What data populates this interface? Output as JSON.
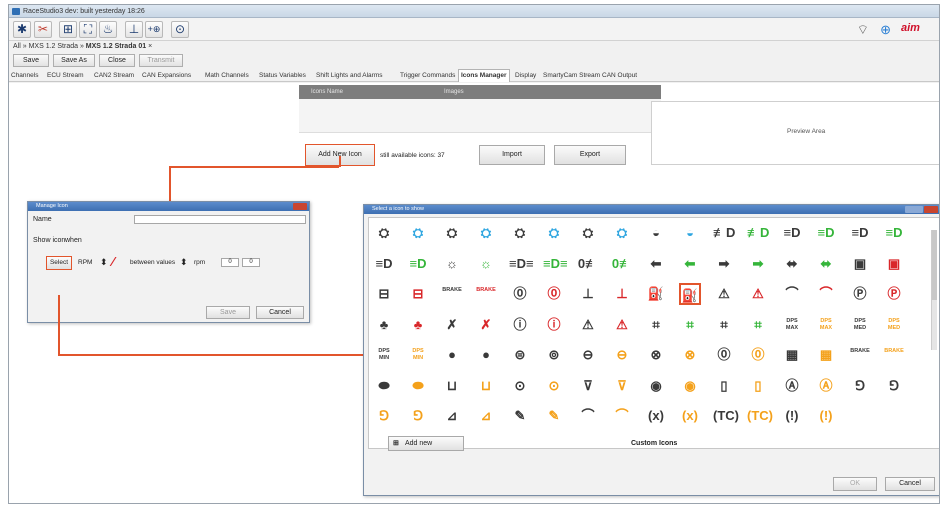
{
  "window": {
    "title": "RaceStudio3 dev: built yesterday 18:26"
  },
  "toolbar": {
    "buttons": [
      "✱",
      "✂",
      "⊞",
      "⛶",
      "♨",
      "⊥",
      "+⊕",
      "⊙"
    ],
    "right_icons": [
      "wifi-icon",
      "globe-icon"
    ],
    "brand": "aim"
  },
  "breadcrumb": {
    "root": "All",
    "item1": "MXS 1.2 Strada",
    "item2": "MXS 1.2 Strada 01"
  },
  "actions": {
    "save": "Save",
    "save_as": "Save As",
    "close": "Close",
    "transmit": "Transmit"
  },
  "tabs": [
    "Channels",
    "ECU Stream",
    "CAN2 Stream",
    "CAN Expansions",
    "Math Channels",
    "Status Variables",
    "Shift Lights and Alarms",
    "Trigger Commands",
    "Icons Manager",
    "Display",
    "SmartyCam Stream",
    "CAN Output"
  ],
  "icons_manager": {
    "col_icons_name": "Icons Name",
    "col_images": "Images",
    "add_new_icon": "Add New Icon",
    "still_available": "still available icons: 37",
    "import": "Import",
    "export": "Export",
    "preview_area": "Preview Area"
  },
  "manage_icon": {
    "title": "Manage Icon",
    "name_label": "Name",
    "name_value": "",
    "show_icon_label": "Show icon",
    "when_label": "when",
    "select_btn": "Select",
    "channel": "RPM",
    "condition": "between values",
    "unit": "rpm",
    "val1": "0",
    "val2": "0",
    "save": "Save",
    "cancel": "Cancel"
  },
  "select_icon": {
    "title": "Select a icon to show",
    "custom_icons": "Custom Icons",
    "add_new": "Add new",
    "ok": "OK",
    "cancel": "Cancel",
    "rows": [
      [
        [
          "dark",
          "⛭"
        ],
        [
          "blue",
          "⛭"
        ],
        [
          "dark",
          "⛭"
        ],
        [
          "blue",
          "⛭"
        ],
        [
          "dark",
          "⛭"
        ],
        [
          "blue",
          "⛭"
        ],
        [
          "dark",
          "⛭"
        ],
        [
          "blue",
          "⛭"
        ],
        [
          "dark",
          "◒"
        ],
        [
          "blue",
          "◒"
        ],
        [
          "dark",
          "≢D"
        ],
        [
          "green",
          "≢D"
        ],
        [
          "dark",
          "≡D"
        ],
        [
          "green",
          "≡D"
        ],
        [
          "dark",
          "≡D"
        ],
        [
          "green",
          "≡D"
        ]
      ],
      [
        [
          "dark",
          "≡D"
        ],
        [
          "green",
          "≡D"
        ],
        [
          "dark",
          "☼"
        ],
        [
          "green",
          "☼"
        ],
        [
          "dark",
          "≡D≡"
        ],
        [
          "green",
          "≡D≡"
        ],
        [
          "dark",
          "0≢"
        ],
        [
          "green",
          "0≢"
        ],
        [
          "dark",
          "⬅"
        ],
        [
          "green",
          "⬅"
        ],
        [
          "dark",
          "➡"
        ],
        [
          "green",
          "➡"
        ],
        [
          "dark",
          "⬌"
        ],
        [
          "green",
          "⬌"
        ],
        [
          "dark",
          "▣"
        ],
        [
          "red",
          "▣"
        ]
      ],
      [
        [
          "dark",
          "⊟"
        ],
        [
          "red",
          "⊟"
        ],
        [
          "small dark",
          "BRAKE"
        ],
        [
          "small red",
          "BRAKE"
        ],
        [
          "dark",
          "⓪"
        ],
        [
          "red",
          "⓪"
        ],
        [
          "dark",
          "⊥"
        ],
        [
          "red",
          "⊥"
        ],
        [
          "dark",
          "⛽"
        ],
        [
          "red",
          "⛽"
        ],
        [
          "dark",
          "⚠"
        ],
        [
          "red",
          "⚠"
        ],
        [
          "dark",
          "⌒"
        ],
        [
          "red",
          "⌒"
        ],
        [
          "dark",
          "Ⓟ"
        ],
        [
          "red",
          "Ⓟ"
        ]
      ],
      [
        [
          "dark",
          "♣"
        ],
        [
          "red",
          "♣"
        ],
        [
          "dark",
          "✗"
        ],
        [
          "red",
          "✗"
        ],
        [
          "dark",
          "ⓘ"
        ],
        [
          "red",
          "ⓘ"
        ],
        [
          "dark",
          "⚠"
        ],
        [
          "red",
          "⚠"
        ],
        [
          "dark",
          "⌗"
        ],
        [
          "green",
          "⌗"
        ],
        [
          "dark",
          "⌗"
        ],
        [
          "green",
          "⌗"
        ],
        [
          "small dark",
          "DPS MAX"
        ],
        [
          "small orange",
          "DPS MAX"
        ],
        [
          "small dark",
          "DPS MED"
        ],
        [
          "small orange",
          "DPS MED"
        ]
      ],
      [
        [
          "small dark",
          "DPS MIN"
        ],
        [
          "small orange",
          "DPS MIN"
        ],
        [
          "dark",
          "●"
        ],
        [
          "dark",
          "●"
        ],
        [
          "dark",
          "⊜"
        ],
        [
          "dark",
          "⊚"
        ],
        [
          "dark",
          "⊖"
        ],
        [
          "orange",
          "⊖"
        ],
        [
          "dark",
          "⊗"
        ],
        [
          "orange",
          "⊗"
        ],
        [
          "dark",
          "⓪"
        ],
        [
          "orange",
          "⓪"
        ],
        [
          "dark",
          "▦"
        ],
        [
          "orange",
          "▦"
        ],
        [
          "small dark",
          "BRAKE"
        ],
        [
          "small orange",
          "BRAKE"
        ]
      ],
      [
        [
          "dark",
          "⬬"
        ],
        [
          "orange",
          "⬬"
        ],
        [
          "dark",
          "⊔"
        ],
        [
          "orange",
          "⊔"
        ],
        [
          "dark",
          "⊙"
        ],
        [
          "orange",
          "⊙"
        ],
        [
          "dark",
          "⊽"
        ],
        [
          "orange",
          "⊽"
        ],
        [
          "dark",
          "◉"
        ],
        [
          "orange",
          "◉"
        ],
        [
          "dark",
          "▯"
        ],
        [
          "orange",
          "▯"
        ],
        [
          "dark",
          "Ⓐ"
        ],
        [
          "orange",
          "Ⓐ"
        ],
        [
          "dark",
          "⅁"
        ],
        [
          "dark",
          "⅁"
        ]
      ],
      [
        [
          "orange",
          "⅁"
        ],
        [
          "orange",
          "⅁"
        ],
        [
          "dark",
          "⊿"
        ],
        [
          "orange",
          "⊿"
        ],
        [
          "dark",
          "✎"
        ],
        [
          "orange",
          "✎"
        ],
        [
          "dark",
          "⌒"
        ],
        [
          "orange",
          "⌒"
        ],
        [
          "dark",
          "(x)"
        ],
        [
          "orange",
          "(x)"
        ],
        [
          "dark",
          "(TC)"
        ],
        [
          "orange",
          "(TC)"
        ],
        [
          "dark",
          "(!)"
        ],
        [
          "orange",
          "(!)"
        ]
      ]
    ]
  }
}
